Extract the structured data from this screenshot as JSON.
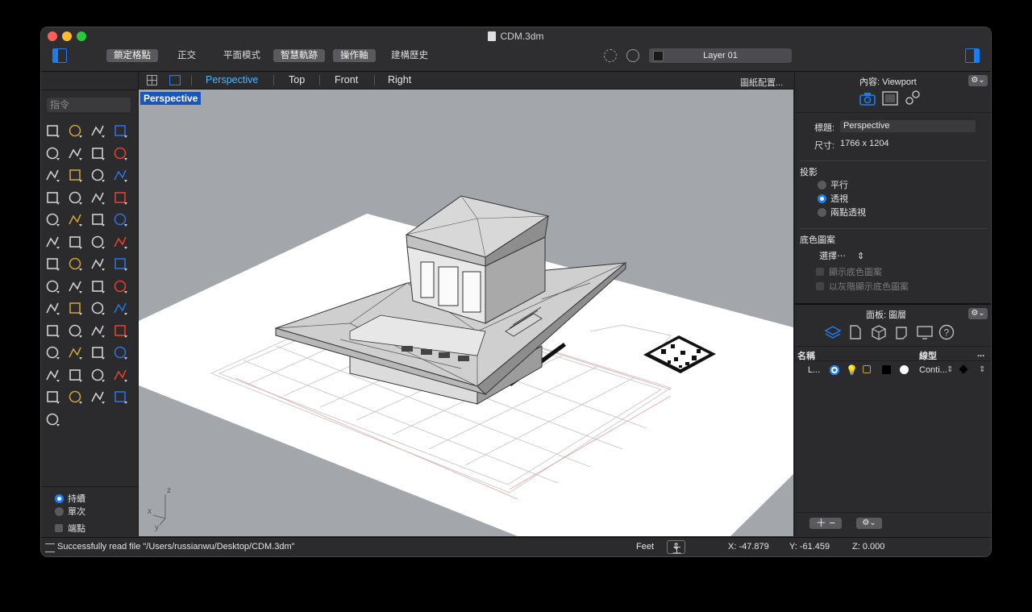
{
  "window": {
    "title": "CDM.3dm"
  },
  "toolbar": {
    "buttons": [
      {
        "label": "鎖定格點",
        "active": true
      },
      {
        "label": "正交",
        "active": false
      },
      {
        "label": "平面模式",
        "active": false
      },
      {
        "label": "智慧軌跡",
        "active": true
      },
      {
        "label": "操作軸",
        "active": true
      },
      {
        "label": "建構歷史",
        "active": false
      }
    ],
    "layer": "Layer 01"
  },
  "command": {
    "placeholder": "指令"
  },
  "osnap": {
    "continuous": "持續",
    "once": "單次",
    "endpoint": "端點"
  },
  "viewport": {
    "tabs": [
      "Perspective",
      "Top",
      "Front",
      "Right"
    ],
    "active_tab": "Perspective",
    "layout_label": "圖紙配置...",
    "label": "Perspective",
    "axes": {
      "z": "z",
      "x": "x",
      "y": "y"
    }
  },
  "properties": {
    "header": "內容: Viewport",
    "title_label": "標題:",
    "title_value": "Perspective",
    "size_label": "尺寸:",
    "size_value": "1766 x 1204",
    "projection_label": "投影",
    "projection_options": [
      "平行",
      "透視",
      "兩點透視"
    ],
    "background_label": "底色圖案",
    "select_label": "選擇⋯",
    "show_bg": "顯示底色圖案",
    "gray_bg": "以灰階顯示底色圖案"
  },
  "layers": {
    "header": "面板: 圖層",
    "col_name": "名稱",
    "col_linetype": "線型",
    "col_more": "...",
    "row_name": "L...",
    "row_linetype": "Conti..."
  },
  "status": {
    "message": "Successfully read file \"/Users/russianwu/Desktop/CDM.3dm\"",
    "units": "Feet",
    "cplane": "工作平面",
    "x": "X: -47.879",
    "y": "Y: -61.459",
    "z": "Z: 0.000"
  },
  "colors": {
    "accent": "#1e7cf0",
    "active_tab": "#4fb6ff",
    "viewport_bg": "#a3a6ab"
  }
}
